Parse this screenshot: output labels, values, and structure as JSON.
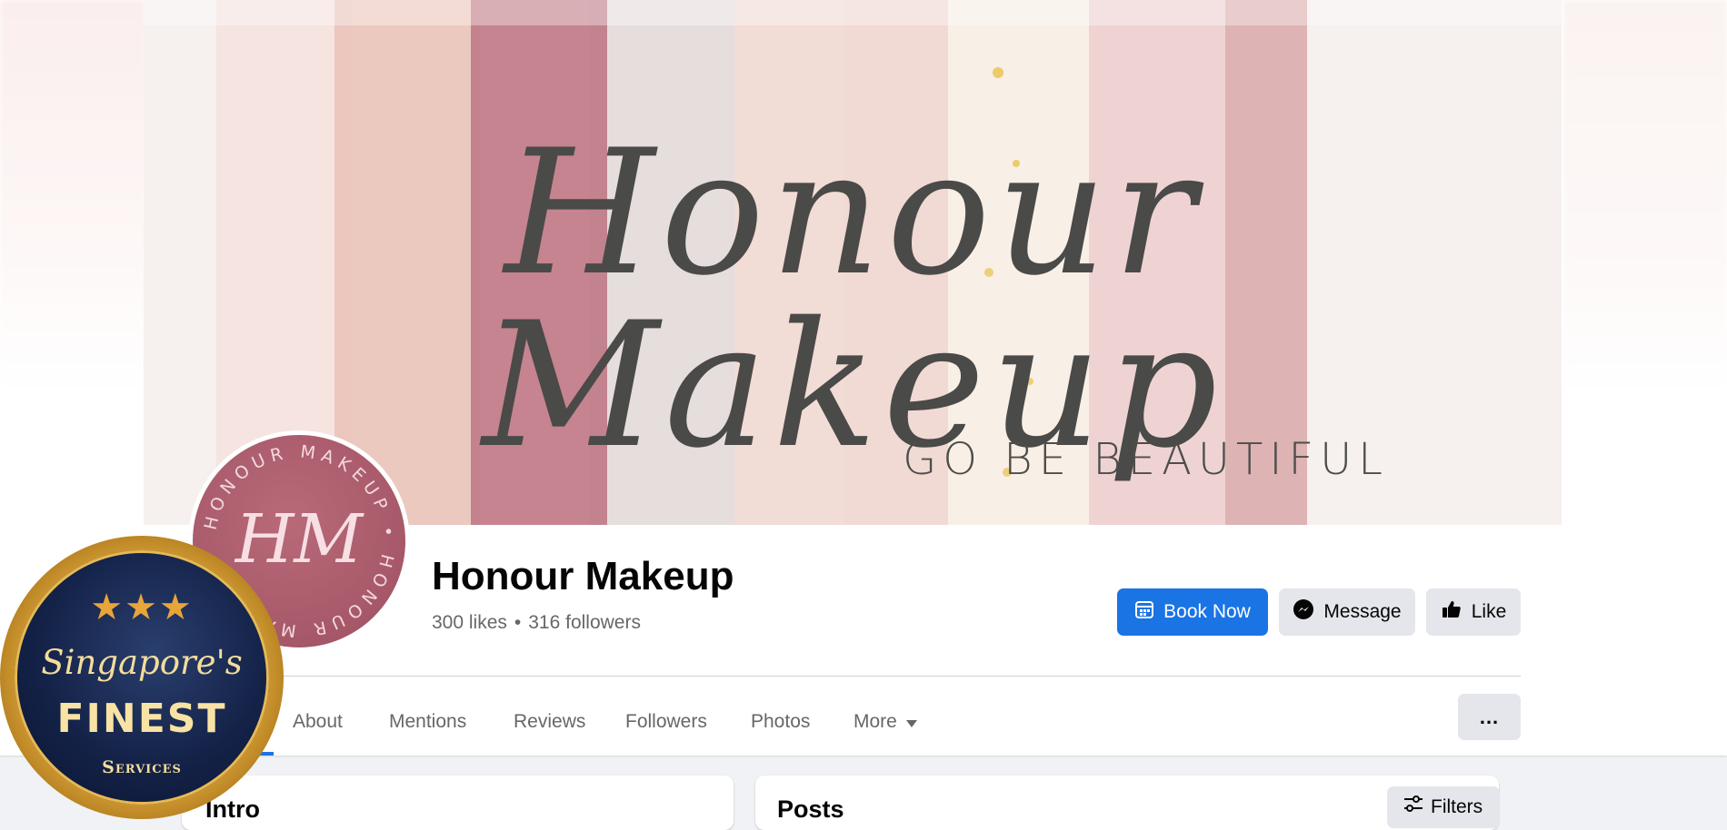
{
  "cover": {
    "title": "Honour Makeup",
    "tagline": "GO BE BEAUTIFUL"
  },
  "avatar": {
    "ring_text": "HONOUR MAKEUP • HONOUR MAKEUP",
    "monogram": "HM"
  },
  "page": {
    "name": "Honour Makeup",
    "likes": "300 likes",
    "separator": "•",
    "followers": "316 followers"
  },
  "actions": {
    "book_now": "Book Now",
    "message": "Message",
    "like": "Like",
    "book_icon": "calendar-icon",
    "message_icon": "messenger-icon",
    "like_icon": "thumbs-up-icon"
  },
  "tabs": [
    {
      "label": "About"
    },
    {
      "label": "Mentions"
    },
    {
      "label": "Reviews"
    },
    {
      "label": "Followers"
    },
    {
      "label": "Photos"
    },
    {
      "label": "More"
    }
  ],
  "more_menu": "...",
  "intro": {
    "title": "Intro"
  },
  "posts": {
    "title": "Posts",
    "filters_label": "Filters"
  },
  "badge": {
    "script": "Singapore's",
    "main": "FINEST",
    "sub": "Services"
  },
  "colors": {
    "accent": "#1b74e4",
    "background": "#f0f2f5",
    "secondary_button": "#e4e6eb",
    "avatar": "#a95b6b"
  }
}
